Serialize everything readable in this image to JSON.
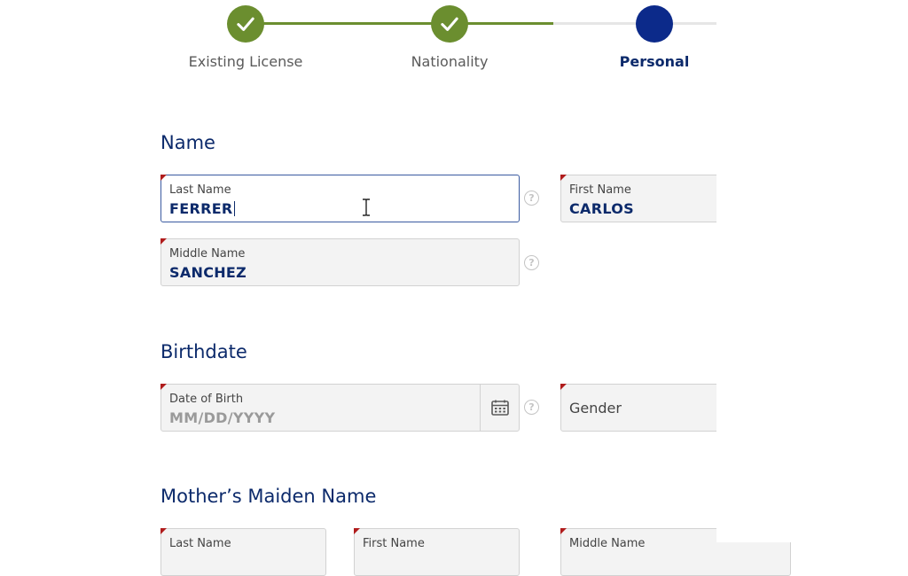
{
  "stepper": {
    "steps": [
      {
        "label": "Existing License",
        "state": "complete"
      },
      {
        "label": "Nationality",
        "state": "complete"
      },
      {
        "label": "Personal",
        "state": "active"
      }
    ],
    "colors": {
      "complete": "#6b8e2f",
      "active": "#0c2a8a",
      "inactive_line": "#e6e6e6"
    }
  },
  "sections": {
    "name": {
      "title": "Name",
      "last_name": {
        "label": "Last Name",
        "value": "FERRER"
      },
      "first_name": {
        "label": "First Name",
        "value": "CARLOS"
      },
      "middle_name": {
        "label": "Middle Name",
        "value": "SANCHEZ"
      }
    },
    "birthdate": {
      "title": "Birthdate",
      "dob": {
        "label": "Date of Birth",
        "placeholder": "MM/DD/YYYY"
      },
      "gender": {
        "placeholder": "Gender"
      }
    },
    "mothers_maiden_name": {
      "title": "Mother’s Maiden Name",
      "last_name": {
        "label": "Last Name"
      },
      "first_name": {
        "label": "First Name"
      },
      "middle_name": {
        "label": "Middle Name"
      }
    }
  },
  "help_glyph": "?",
  "icons": {
    "check": "check-icon",
    "calendar": "calendar-icon",
    "help": "help-icon",
    "cursor": "text-cursor-icon"
  }
}
